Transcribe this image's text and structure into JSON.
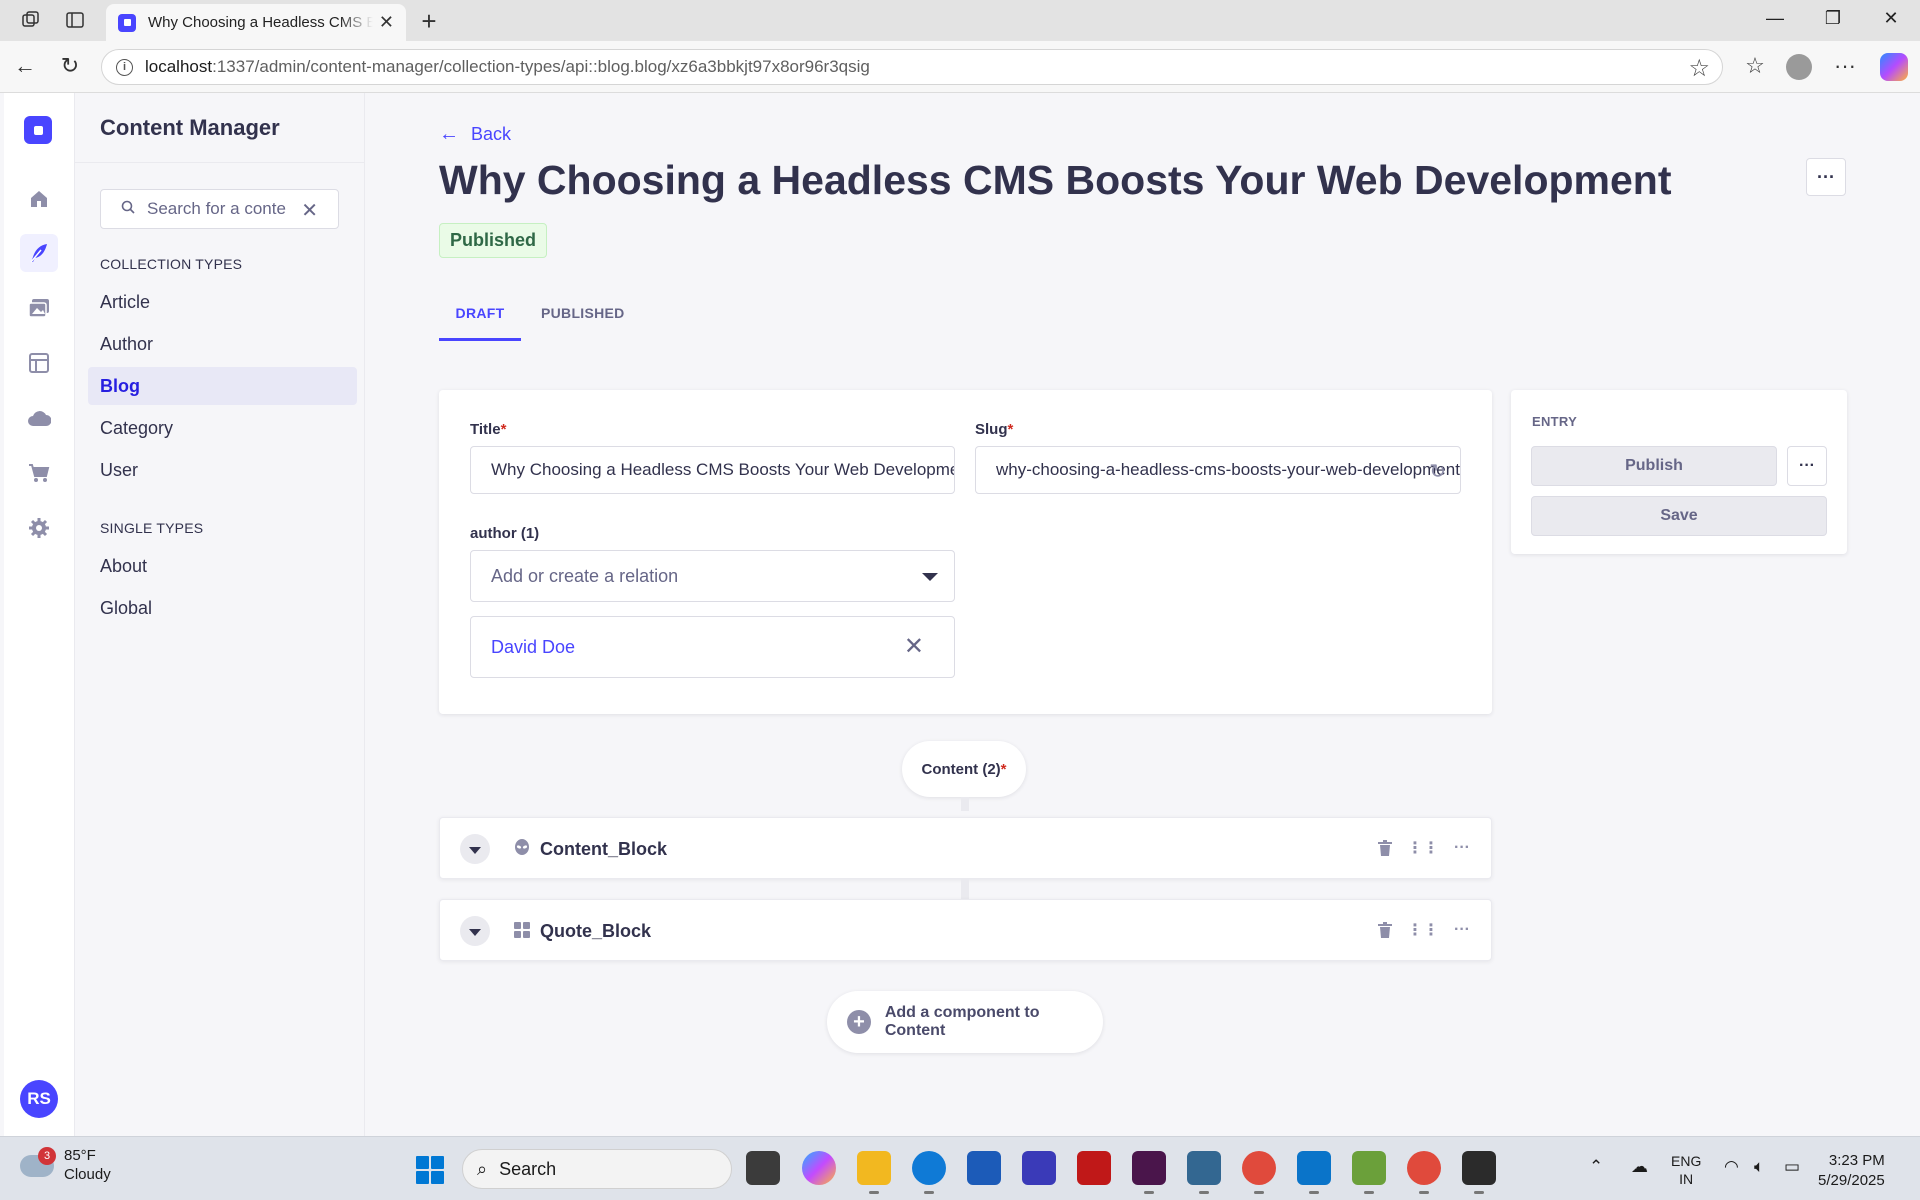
{
  "browser": {
    "tab_title": "Why Choosing a Headless CMS Boosts Your Web Development",
    "url_host": "localhost",
    "url_path": ":1337/admin/content-manager/collection-types/api::blog.blog/xz6a3bbkjt97x8or96r3qsig"
  },
  "subnav": {
    "title": "Content Manager",
    "search_placeholder": "Search for a content type",
    "collection_label": "COLLECTION TYPES",
    "collection_items": [
      "Article",
      "Author",
      "Blog",
      "Category",
      "User"
    ],
    "single_label": "SINGLE TYPES",
    "single_items": [
      "About",
      "Global"
    ]
  },
  "rail": {
    "avatar_initials": "RS",
    "icons": [
      "home-icon",
      "content-manager-icon",
      "media-library-icon",
      "content-type-builder-icon",
      "cloud-icon",
      "marketplace-icon",
      "settings-icon"
    ]
  },
  "header": {
    "back_label": "Back",
    "title": "Why Choosing a Headless CMS Boosts Your Web Development",
    "status": "Published",
    "more_label": "···"
  },
  "tabs": [
    "DRAFT",
    "PUBLISHED"
  ],
  "form": {
    "title_label": "Title",
    "title_value": "Why Choosing a Headless CMS Boosts Your Web Development",
    "slug_label": "Slug",
    "slug_value": "why-choosing-a-headless-cms-boosts-your-web-development",
    "required_mark": "*",
    "author_label": "author (1)",
    "author_placeholder": "Add or create a relation",
    "author_selected": "David Doe"
  },
  "entry_panel": {
    "label": "ENTRY",
    "publish_label": "Publish",
    "save_label": "Save",
    "more_label": "···"
  },
  "dynamic_zone": {
    "label": "Content (2)",
    "components": [
      {
        "name": "Content_Block",
        "icon": "alien-icon"
      },
      {
        "name": "Quote_Block",
        "icon": "grid-icon"
      }
    ],
    "add_label": "Add a component to Content"
  },
  "taskbar": {
    "weather_temp": "85°F",
    "weather_desc": "Cloudy",
    "weather_badge": "3",
    "search_label": "Search",
    "language": "ENG",
    "region": "IN",
    "time": "3:23 PM",
    "date": "5/29/2025"
  },
  "colors": {
    "primary": "#4945ff",
    "published_bg": "#eafbe7",
    "published_text": "#2f6846",
    "required": "#d02b20"
  }
}
